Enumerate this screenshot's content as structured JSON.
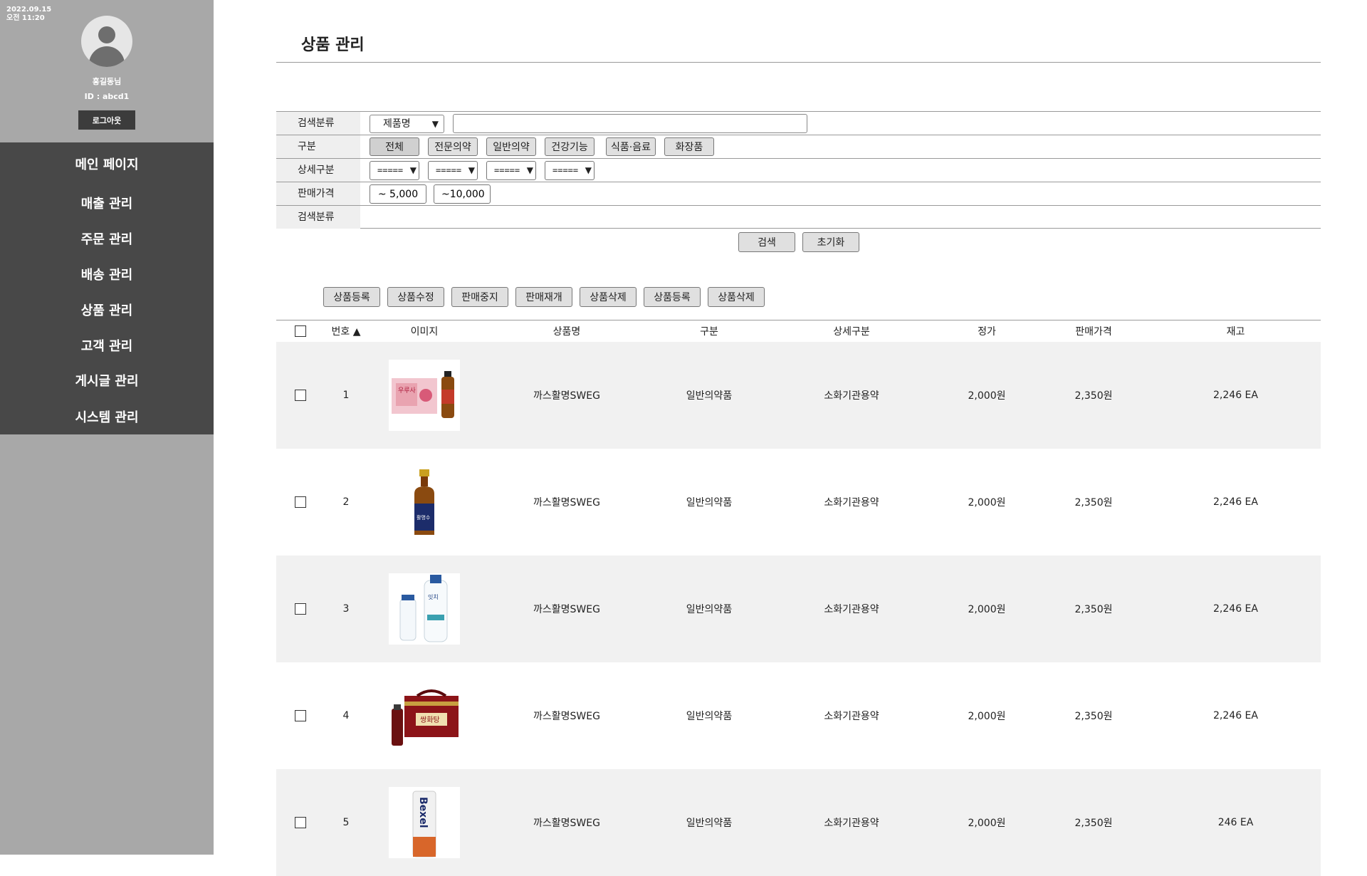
{
  "sidebar": {
    "date": "2022.09.15",
    "time": "오전 11:20",
    "user_name": "홍길동님",
    "user_id": "ID : abcd1",
    "logout_label": "로그아웃",
    "menu": [
      "메인 페이지",
      "매출 관리",
      "주문 관리",
      "배송 관리",
      "상품 관리",
      "고객 관리",
      "게시글 관리",
      "시스템 관리"
    ]
  },
  "page": {
    "title": "상품 관리"
  },
  "search": {
    "row1_label": "검색분류",
    "category_select": "제품명",
    "keyword_value": "",
    "row2_label": "구분",
    "type_buttons": [
      "전체",
      "전문의약",
      "일반의약",
      "건강기능",
      "식품·음료",
      "화장품"
    ],
    "row3_label": "상세구분",
    "detail_selects": [
      "=====",
      "=====",
      "=====",
      "====="
    ],
    "row4_label": "판매가격",
    "price_buttons": [
      "~ 5,000",
      "~10,000"
    ],
    "row5_label": "검색분류",
    "search_label": "검색",
    "reset_label": "초기화"
  },
  "actions": [
    "상품등록",
    "상품수정",
    "판매중지",
    "판매재개",
    "상품삭제",
    "상품등록",
    "상품삭제"
  ],
  "table": {
    "headers": [
      "번호 ▲",
      "이미지",
      "상품명",
      "구분",
      "상세구분",
      "정가",
      "판매가격",
      "재고"
    ],
    "rows": [
      {
        "no": "1",
        "name": "까스활명SWEG",
        "type": "일반의약품",
        "detail": "소화기관용약",
        "list_price": "2,000원",
        "sale_price": "2,350원",
        "stock": "2,246 EA"
      },
      {
        "no": "2",
        "name": "까스활명SWEG",
        "type": "일반의약품",
        "detail": "소화기관용약",
        "list_price": "2,000원",
        "sale_price": "2,350원",
        "stock": "2,246 EA"
      },
      {
        "no": "3",
        "name": "까스활명SWEG",
        "type": "일반의약품",
        "detail": "소화기관용약",
        "list_price": "2,000원",
        "sale_price": "2,350원",
        "stock": "2,246 EA"
      },
      {
        "no": "4",
        "name": "까스활명SWEG",
        "type": "일반의약품",
        "detail": "소화기관용약",
        "list_price": "2,000원",
        "sale_price": "2,350원",
        "stock": "2,246 EA"
      },
      {
        "no": "5",
        "name": "까스활명SWEG",
        "type": "일반의약품",
        "detail": "소화기관용약",
        "list_price": "2,000원",
        "sale_price": "2,350원",
        "stock": "246 EA"
      }
    ],
    "image_labels": [
      "우루사",
      "활명수",
      "잇치",
      "쌍화탕",
      "Bexel"
    ]
  }
}
